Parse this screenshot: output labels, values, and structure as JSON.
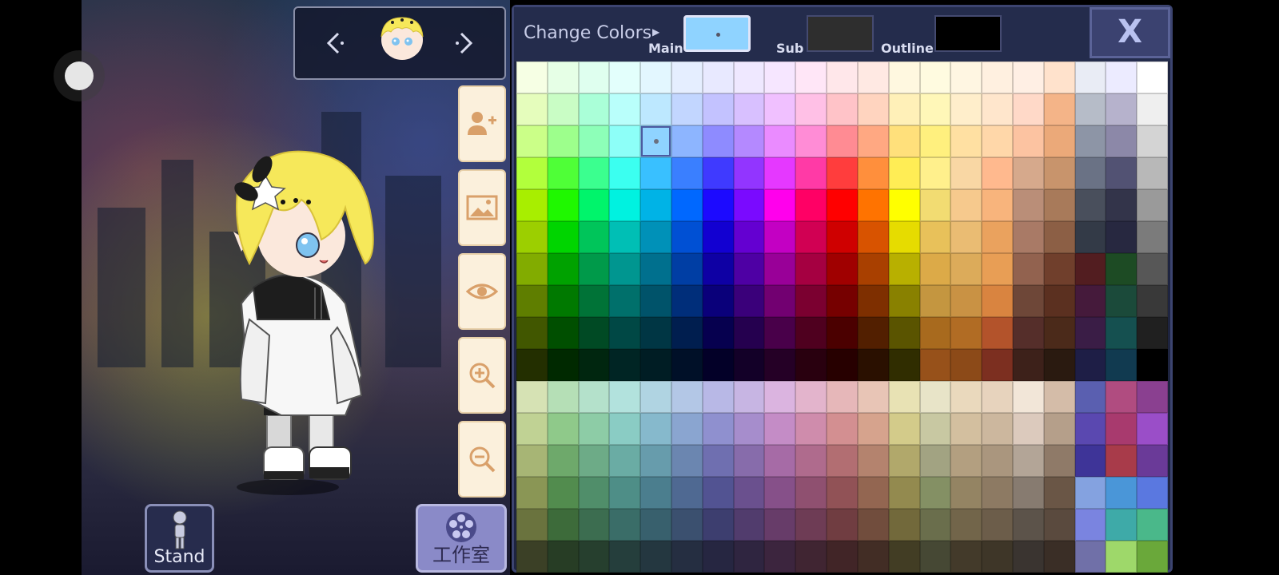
{
  "header": {
    "title": "Change Colors",
    "main_label": "Main",
    "sub_label": "Sub",
    "outline_label": "Outline",
    "close_label": "X"
  },
  "swatches": {
    "main": "#8fd3ff",
    "sub": "#2e2e2e",
    "outline": "#000000"
  },
  "char_nav": {
    "prev_icon": "chevron-left-icon",
    "next_icon": "chevron-right-icon"
  },
  "tools": [
    {
      "name": "add-character",
      "icon": "add-user-icon"
    },
    {
      "name": "background",
      "icon": "image-icon"
    },
    {
      "name": "visibility",
      "icon": "eye-icon"
    },
    {
      "name": "zoom-in",
      "icon": "zoom-in-icon"
    },
    {
      "name": "zoom-out",
      "icon": "zoom-out-icon"
    }
  ],
  "bottom": {
    "stand_label": "Stand",
    "studio_label": "工作室"
  },
  "palette": {
    "selected": {
      "row": 2,
      "col": 4
    },
    "rows": [
      [
        "#f6ffe4",
        "#e6ffe6",
        "#dfffef",
        "#e3fffc",
        "#e3f7ff",
        "#e5eeff",
        "#e8e9ff",
        "#efe8ff",
        "#f6e6ff",
        "#ffe6f7",
        "#ffe7ea",
        "#ffe9e3",
        "#fff8e0",
        "#fffbe0",
        "#fff6e2",
        "#fff0e0",
        "#ffefe4",
        "#ffe2cc",
        "#e9ecf5",
        "#ecebff",
        "#ffffff"
      ],
      [
        "#e5fdbc",
        "#c9fdc5",
        "#aaffd8",
        "#b9fffb",
        "#bde8ff",
        "#c2d6ff",
        "#c3c2ff",
        "#d8c0ff",
        "#f0c0ff",
        "#ffc0e6",
        "#ffc3c8",
        "#ffd4bf",
        "#fff0b8",
        "#fff7b8",
        "#ffeecb",
        "#ffe6cc",
        "#ffd9c8",
        "#f4b488",
        "#b6bcc8",
        "#b6b2cc",
        "#efefef"
      ],
      [
        "#cbff88",
        "#9dff8c",
        "#8dffb8",
        "#8dfff8",
        "#8fd3ff",
        "#8db5ff",
        "#8e8bff",
        "#b489ff",
        "#ea8bff",
        "#ff8cd6",
        "#ff8b93",
        "#ffa882",
        "#ffe07b",
        "#fff07e",
        "#ffe0a2",
        "#ffd7a9",
        "#fcc3a1",
        "#eba979",
        "#8d95a6",
        "#8c88a8",
        "#d4d4d4"
      ],
      [
        "#b2ff3c",
        "#4fff37",
        "#3bff8f",
        "#3bfff0",
        "#39c0ff",
        "#3a7fff",
        "#3f3aff",
        "#9235ff",
        "#e538ff",
        "#ff3aa6",
        "#ff3d3d",
        "#ff8f3c",
        "#ffed55",
        "#fff08c",
        "#f9d7a4",
        "#ffb98e",
        "#d6a98c",
        "#c8946c",
        "#6a7285",
        "#525273",
        "#b8b8b8"
      ],
      [
        "#a8ee00",
        "#1ff800",
        "#00f46b",
        "#00f2e0",
        "#00b3e6",
        "#0068ff",
        "#1c0aff",
        "#7a0aff",
        "#ff00ec",
        "#ff0065",
        "#ff0000",
        "#ff7300",
        "#ffff00",
        "#f2dc72",
        "#f6c98d",
        "#f8b47c",
        "#ba8e78",
        "#a87a5a",
        "#494f5c",
        "#33344a",
        "#9a9a9a"
      ],
      [
        "#9ccf00",
        "#00d500",
        "#00c55a",
        "#00bfb5",
        "#0091b8",
        "#0050d4",
        "#1200d1",
        "#6400d1",
        "#c300c3",
        "#d10053",
        "#cf0000",
        "#d85300",
        "#e6dc00",
        "#e8c15a",
        "#eabc73",
        "#eaa25e",
        "#a97a66",
        "#8c5f45",
        "#333a47",
        "#272840",
        "#7b7b7b"
      ],
      [
        "#82ac00",
        "#00a200",
        "#009a4a",
        "#009690",
        "#00708e",
        "#003ea4",
        "#0e00a4",
        "#4e00a4",
        "#990098",
        "#a50041",
        "#a00000",
        "#a94000",
        "#b8b000",
        "#dcaa48",
        "#dcab5a",
        "#e89e55",
        "#92624f",
        "#703f2c",
        "#521d20",
        "#1d4b24",
        "#575757"
      ],
      [
        "#5f7e00",
        "#007900",
        "#007337",
        "#00706b",
        "#00536a",
        "#002e7a",
        "#0a007a",
        "#3a007a",
        "#720071",
        "#7b0030",
        "#760000",
        "#7e2f00",
        "#898100",
        "#c49640",
        "#c99244",
        "#d98440",
        "#6e4738",
        "#5b3020",
        "#451a3b",
        "#1b4a3a",
        "#393939"
      ],
      [
        "#415700",
        "#004f00",
        "#004a24",
        "#004845",
        "#003644",
        "#001e4f",
        "#06004f",
        "#25004f",
        "#49004a",
        "#4f001f",
        "#4b0000",
        "#521f00",
        "#5a5400",
        "#a86a1e",
        "#b16c24",
        "#b3532b",
        "#552e2a",
        "#4b2a1a",
        "#3a1d46",
        "#155050",
        "#202020"
      ],
      [
        "#232f00",
        "#002900",
        "#00260f",
        "#002524",
        "#001d24",
        "#001028",
        "#030028",
        "#130028",
        "#250026",
        "#29000f",
        "#270000",
        "#2a1000",
        "#302d00",
        "#97511a",
        "#8c4a18",
        "#7c2f20",
        "#3d211a",
        "#2a1a10",
        "#1e1e46",
        "#113a50",
        "#000000"
      ],
      [
        "#d6e2b4",
        "#b5dfb6",
        "#b4e1cb",
        "#b2e2dd",
        "#b0d4e2",
        "#b3c7e6",
        "#b8b8e6",
        "#c7b5e3",
        "#dbb4e0",
        "#e3b4cc",
        "#e6b7b9",
        "#e8c5b6",
        "#e8e2b4",
        "#e8e4c8",
        "#ead9bd",
        "#e7d3bd",
        "#f2e6d8",
        "#d4bca8",
        "#5a5fb0",
        "#b04c80",
        "#8a4090"
      ],
      [
        "#c0d294",
        "#8fc98a",
        "#8dcca6",
        "#8accc4",
        "#86b9cc",
        "#8aa5d0",
        "#8f90cf",
        "#a68dcc",
        "#c48cc6",
        "#cf8cac",
        "#d38f91",
        "#d6a38d",
        "#d3cb8a",
        "#c8c8a2",
        "#d3bf9f",
        "#ccb79e",
        "#dccabd",
        "#b59f8a",
        "#5a48b0",
        "#a83a6e",
        "#9a4ec8"
      ],
      [
        "#a7b575",
        "#6ea96b",
        "#6dab87",
        "#6aaca4",
        "#679cac",
        "#6b86b0",
        "#6f6fb0",
        "#876cab",
        "#a66ba6",
        "#af6b8d",
        "#b26e72",
        "#b4836e",
        "#b1a86b",
        "#a2a382",
        "#b39f80",
        "#aa967e",
        "#b3a597",
        "#8f7a68",
        "#3e3498",
        "#a83b4a",
        "#6a3a98"
      ],
      [
        "#8a9655",
        "#528c4e",
        "#508e6a",
        "#4e8e87",
        "#4b7e8e",
        "#4f6992",
        "#525392",
        "#6a508e",
        "#865089",
        "#8f5070",
        "#915256",
        "#936651",
        "#938a4f",
        "#849064",
        "#948463",
        "#8d7a63",
        "#877b70",
        "#6a5646",
        "#84a2e0",
        "#4a96d8",
        "#5a78e0"
      ],
      [
        "#6a733e",
        "#3d6b3a",
        "#3c6d50",
        "#3a6d68",
        "#38606d",
        "#3b506f",
        "#3d3e6f",
        "#513c6d",
        "#673c69",
        "#6e3c55",
        "#703d41",
        "#714d3d",
        "#72693b",
        "#6a6e4c",
        "#72654a",
        "#6c5d4a",
        "#5c534a",
        "#5a4a3e",
        "#7a84e0",
        "#3eaaa8",
        "#4ab88a"
      ],
      [
        "#3b4026",
        "#273d25",
        "#263f2e",
        "#253e3c",
        "#243740",
        "#252e41",
        "#262641",
        "#2f2540",
        "#3c253e",
        "#402532",
        "#412527",
        "#422d25",
        "#423d24",
        "#464834",
        "#433a2a",
        "#3e3628",
        "#3a3430",
        "#3a2e26",
        "#7070a8",
        "#9ed86a",
        "#6aa83a"
      ]
    ]
  }
}
